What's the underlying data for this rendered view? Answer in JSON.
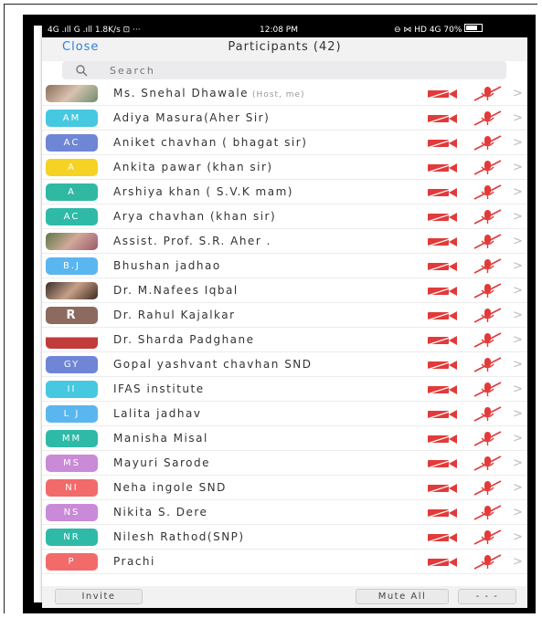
{
  "statusbar": {
    "left": "4G .ıll  G .ıll  1.8K/s  ⊡  ···",
    "time": "12:08 PM",
    "right": "⊖  ⋈  HD 4G  70%"
  },
  "header": {
    "close_label": "Close",
    "title": "Participants (42)"
  },
  "search": {
    "placeholder": "Search"
  },
  "participants": [
    {
      "name": "Ms. Snehal Dhawale",
      "host_tag": "(Host, me)",
      "avatar": "",
      "avatar_color": "",
      "photo": "p1"
    },
    {
      "name": "Adiya Masura(Aher Sir)",
      "avatar": "AM",
      "avatar_color": "#46c8e0"
    },
    {
      "name": "Aniket chavhan ( bhagat sir)",
      "avatar": "AC",
      "avatar_color": "#6f86d6"
    },
    {
      "name": "Ankita  pawar (khan sir)",
      "avatar": "A",
      "avatar_color": "#f5d223"
    },
    {
      "name": "Arshiya  khan ( S.V.K mam)",
      "avatar": "A",
      "avatar_color": "#2fb8a2"
    },
    {
      "name": "Arya chavhan (khan sir)",
      "avatar": "AC",
      "avatar_color": "#2fbaa8"
    },
    {
      "name": "Assist. Prof. S.R. Aher .",
      "avatar": "",
      "avatar_color": "",
      "photo": "p2"
    },
    {
      "name": "Bhushan jadhao",
      "avatar": "B.J",
      "avatar_color": "#5ab6ee"
    },
    {
      "name": "Dr. M.Nafees Iqbal",
      "avatar": "",
      "avatar_color": "",
      "photo": "p3"
    },
    {
      "name": "Dr. Rahul Kajalkar",
      "avatar": "R",
      "avatar_color": "#8c6a5e",
      "big": true
    },
    {
      "name": "Dr. Sharda Padghane",
      "avatar": "",
      "avatar_color": "",
      "photo": "p4"
    },
    {
      "name": "Gopal yashvant chavhan SND",
      "avatar": "GY",
      "avatar_color": "#6f86d6"
    },
    {
      "name": "IFAS institute",
      "avatar": "II",
      "avatar_color": "#46c8e0"
    },
    {
      "name": "Lalita jadhav",
      "avatar": "L J",
      "avatar_color": "#5ab6ee"
    },
    {
      "name": "Manisha Misal",
      "avatar": "MM",
      "avatar_color": "#2fbaa8"
    },
    {
      "name": "Mayuri Sarode",
      "avatar": "MS",
      "avatar_color": "#c98ad8"
    },
    {
      "name": "Neha ingole  SND",
      "avatar": "NI",
      "avatar_color": "#f26a6a"
    },
    {
      "name": "Nikita S. Dere",
      "avatar": "NS",
      "avatar_color": "#c98ad8"
    },
    {
      "name": "Nilesh Rathod(SNP)",
      "avatar": "NR",
      "avatar_color": "#2fbaa8"
    },
    {
      "name": "Prachi",
      "avatar": "P",
      "avatar_color": "#f26a6a"
    }
  ],
  "footer": {
    "invite_label": "Invite",
    "mute_all_label": "Mute All",
    "more_label": "- - -"
  },
  "colors": {
    "accent": "#2f7fd6",
    "muted_red": "#e23a3a"
  },
  "icons": {
    "video": "video-off-icon",
    "mic": "mic-muted-icon",
    "chevron": "chevron-right-icon"
  }
}
